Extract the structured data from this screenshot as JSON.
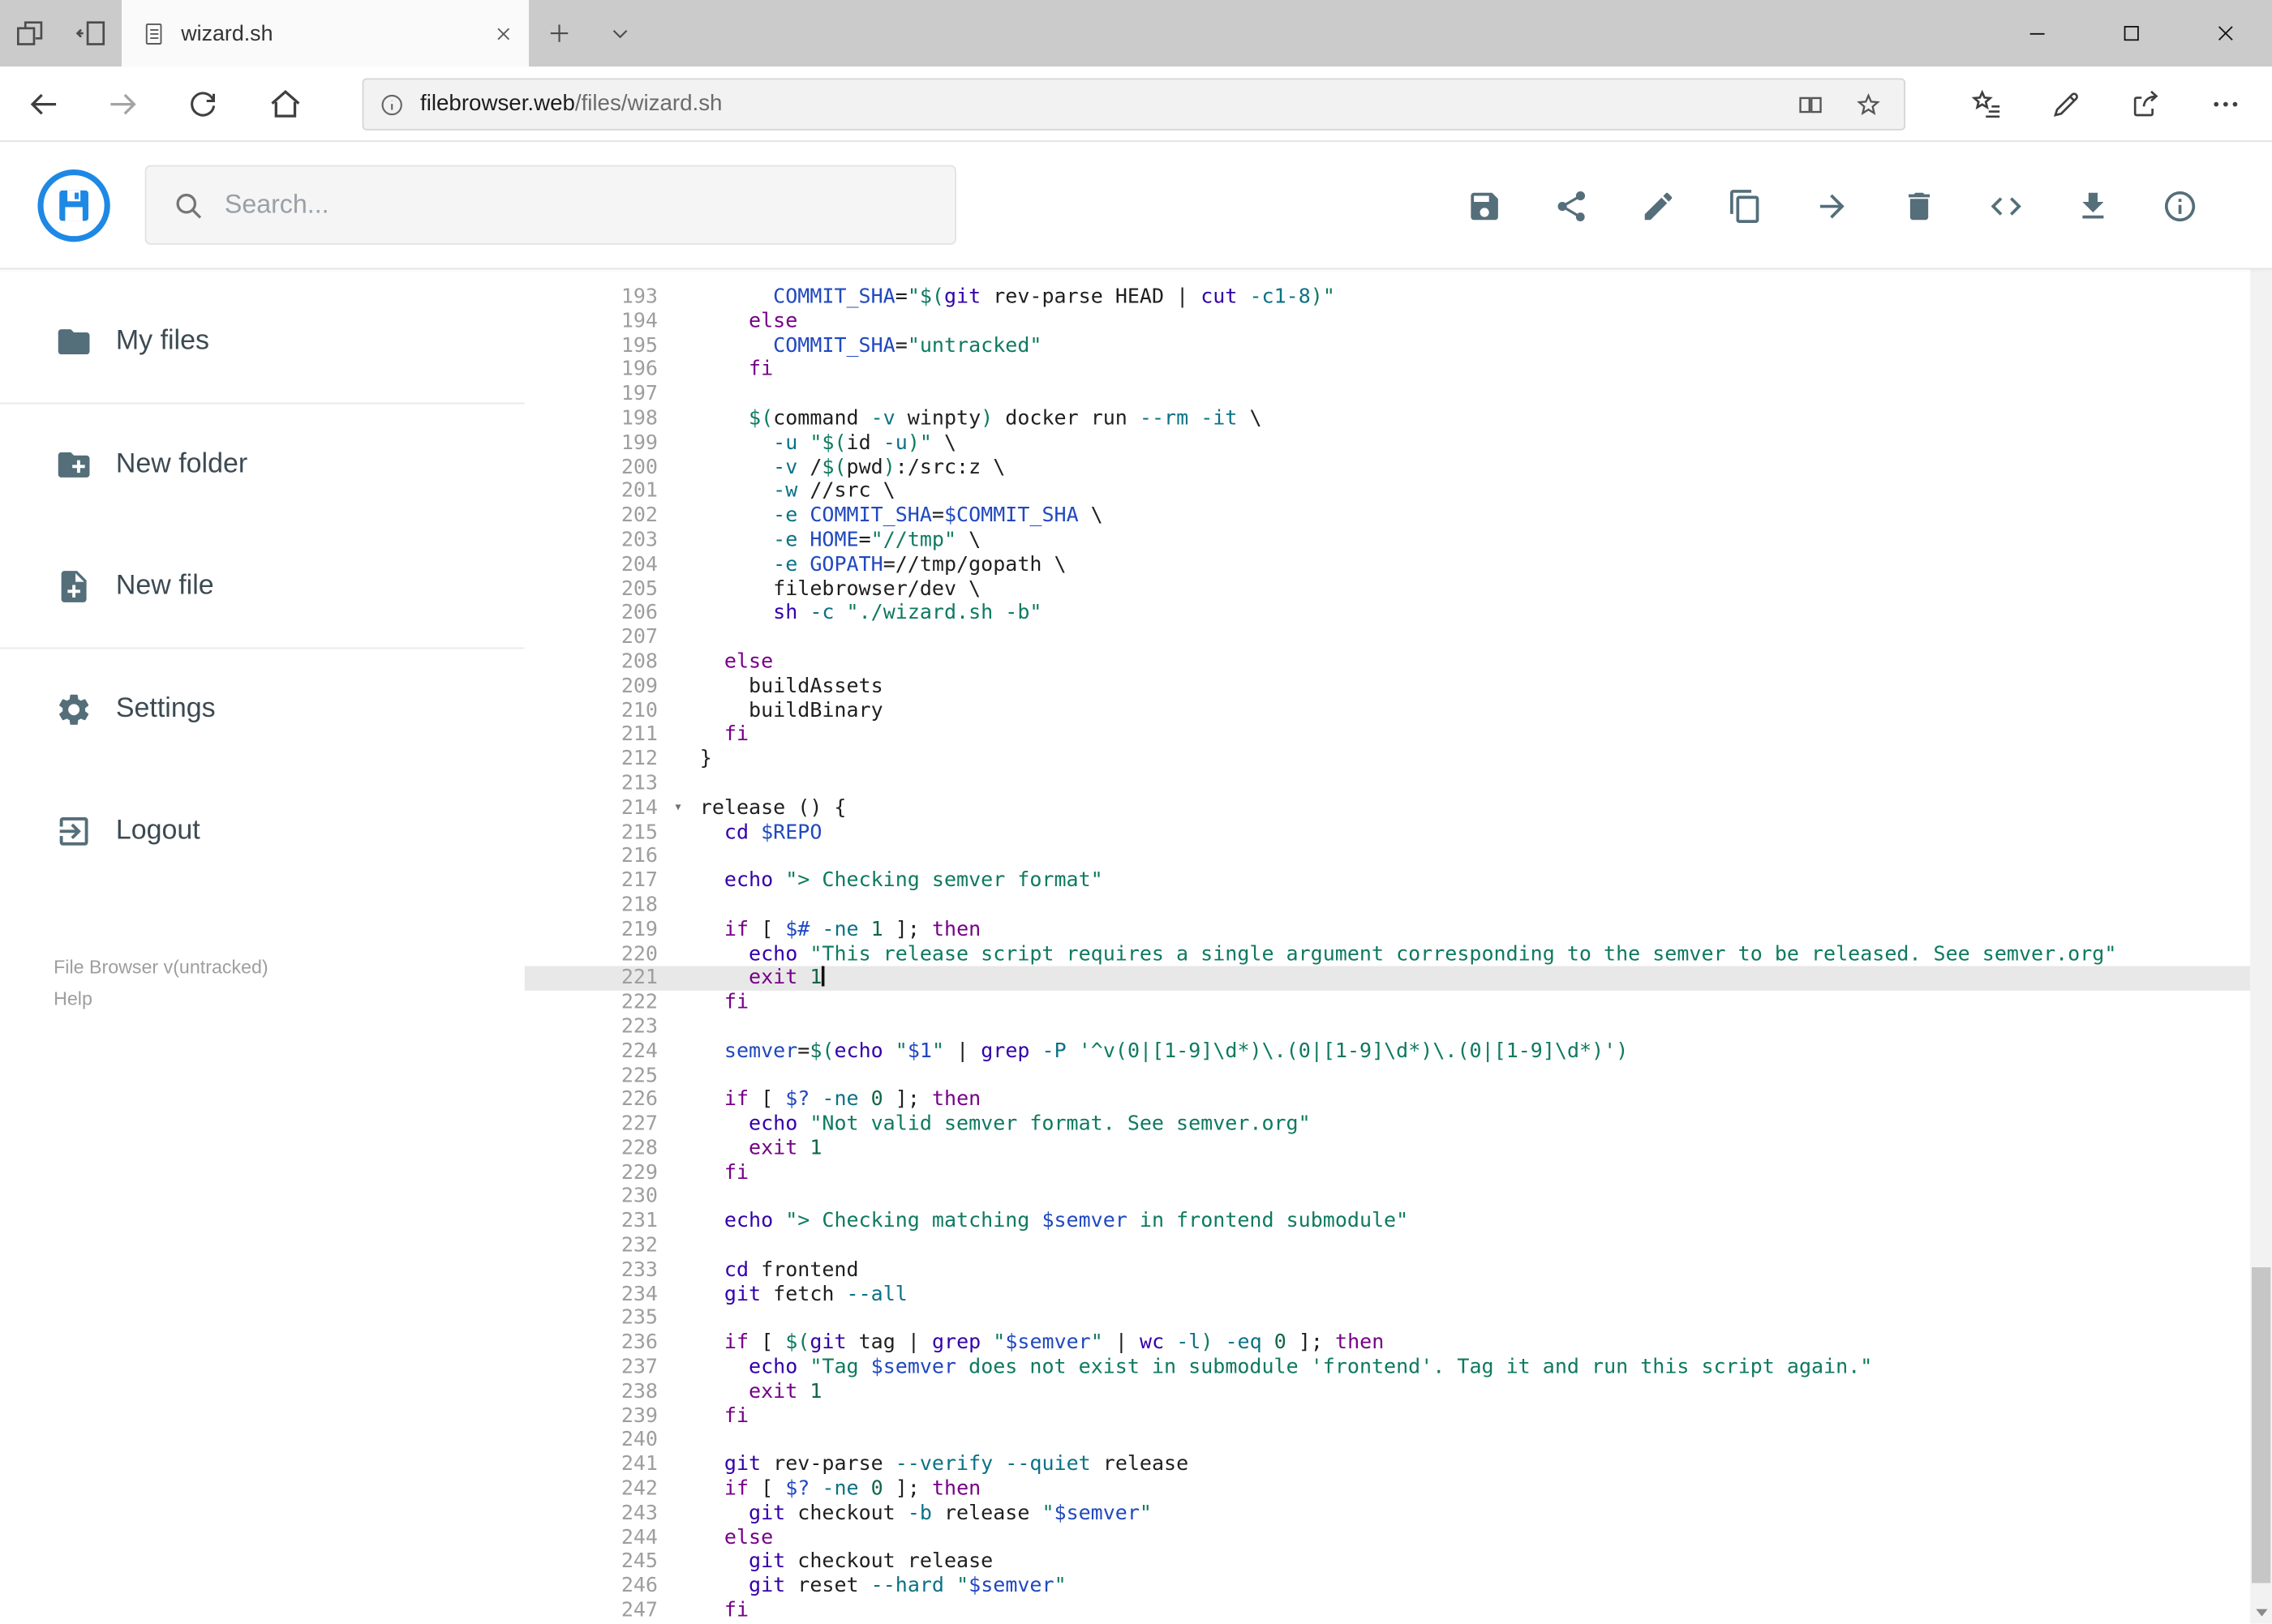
{
  "window": {
    "tab_title": "wizard.sh",
    "url_host": "filebrowser.web",
    "url_path": "/files/wizard.sh"
  },
  "header": {
    "search_placeholder": "Search..."
  },
  "toolbar_icons": [
    "save",
    "share",
    "rename",
    "copy",
    "move",
    "delete",
    "raw-view",
    "download",
    "info"
  ],
  "sidebar": {
    "items": [
      {
        "label": "My files",
        "icon": "folder"
      },
      {
        "label": "New folder",
        "icon": "create-new-folder"
      },
      {
        "label": "New file",
        "icon": "new-file"
      },
      {
        "label": "Settings",
        "icon": "settings"
      },
      {
        "label": "Logout",
        "icon": "logout"
      }
    ],
    "footer": {
      "version": "File Browser v(untracked)",
      "help": "Help"
    }
  },
  "colors": {
    "accent_blue": "#1e88e5",
    "icon_gray": "#546e7a",
    "active_line_bg": "#e8e8e8",
    "syntax": {
      "plain": "#1f1f1f",
      "keyword": "#770088",
      "string": "#0e7a60",
      "variable": "#2048c0",
      "flag": "#0b7285",
      "number": "#116644",
      "builtin": "#3300aa",
      "line_number": "#9e9e9e"
    }
  },
  "editor": {
    "active_line": 221,
    "cursor_line": 221,
    "fold_line": 214,
    "fold_marker": "▾",
    "lines": [
      {
        "n": 193,
        "s": [
          [
            "p",
            "      "
          ],
          [
            "v",
            "COMMIT_SHA"
          ],
          [
            "p",
            "="
          ],
          [
            "s",
            "\"$("
          ],
          [
            "b",
            "git"
          ],
          [
            "p",
            " rev-parse HEAD | "
          ],
          [
            "b",
            "cut"
          ],
          [
            "p",
            " "
          ],
          [
            "a",
            "-c1-8"
          ],
          [
            "s",
            ")\""
          ]
        ]
      },
      {
        "n": 194,
        "s": [
          [
            "p",
            "    "
          ],
          [
            "k",
            "else"
          ]
        ]
      },
      {
        "n": 195,
        "s": [
          [
            "p",
            "      "
          ],
          [
            "v",
            "COMMIT_SHA"
          ],
          [
            "p",
            "="
          ],
          [
            "s",
            "\"untracked\""
          ]
        ]
      },
      {
        "n": 196,
        "s": [
          [
            "p",
            "    "
          ],
          [
            "k",
            "fi"
          ]
        ]
      },
      {
        "n": 197,
        "s": []
      },
      {
        "n": 198,
        "s": [
          [
            "p",
            "    "
          ],
          [
            "s",
            "$("
          ],
          [
            "p",
            "command "
          ],
          [
            "a",
            "-v"
          ],
          [
            "p",
            " winpty"
          ],
          [
            "s",
            ")"
          ],
          [
            "p",
            " docker run "
          ],
          [
            "a",
            "--rm"
          ],
          [
            "p",
            " "
          ],
          [
            "a",
            "-it"
          ],
          [
            "p",
            " \\"
          ]
        ]
      },
      {
        "n": 199,
        "s": [
          [
            "p",
            "      "
          ],
          [
            "a",
            "-u"
          ],
          [
            "p",
            " "
          ],
          [
            "s",
            "\"$("
          ],
          [
            "p",
            "id "
          ],
          [
            "a",
            "-u"
          ],
          [
            "s",
            ")\""
          ],
          [
            "p",
            " \\"
          ]
        ]
      },
      {
        "n": 200,
        "s": [
          [
            "p",
            "      "
          ],
          [
            "a",
            "-v"
          ],
          [
            "p",
            " /"
          ],
          [
            "s",
            "$("
          ],
          [
            "p",
            "pwd"
          ],
          [
            "s",
            ")"
          ],
          [
            "p",
            ":/src:z \\"
          ]
        ]
      },
      {
        "n": 201,
        "s": [
          [
            "p",
            "      "
          ],
          [
            "a",
            "-w"
          ],
          [
            "p",
            " //src \\"
          ]
        ]
      },
      {
        "n": 202,
        "s": [
          [
            "p",
            "      "
          ],
          [
            "a",
            "-e"
          ],
          [
            "p",
            " "
          ],
          [
            "v",
            "COMMIT_SHA"
          ],
          [
            "p",
            "="
          ],
          [
            "v",
            "$COMMIT_SHA"
          ],
          [
            "p",
            " \\"
          ]
        ]
      },
      {
        "n": 203,
        "s": [
          [
            "p",
            "      "
          ],
          [
            "a",
            "-e"
          ],
          [
            "p",
            " "
          ],
          [
            "v",
            "HOME"
          ],
          [
            "p",
            "="
          ],
          [
            "s",
            "\"//tmp\""
          ],
          [
            "p",
            " \\"
          ]
        ]
      },
      {
        "n": 204,
        "s": [
          [
            "p",
            "      "
          ],
          [
            "a",
            "-e"
          ],
          [
            "p",
            " "
          ],
          [
            "v",
            "GOPATH"
          ],
          [
            "p",
            "=//tmp/gopath \\"
          ]
        ]
      },
      {
        "n": 205,
        "s": [
          [
            "p",
            "      filebrowser/dev \\"
          ]
        ]
      },
      {
        "n": 206,
        "s": [
          [
            "p",
            "      "
          ],
          [
            "b",
            "sh"
          ],
          [
            "p",
            " "
          ],
          [
            "a",
            "-c"
          ],
          [
            "p",
            " "
          ],
          [
            "s",
            "\"./wizard.sh -b\""
          ]
        ]
      },
      {
        "n": 207,
        "s": []
      },
      {
        "n": 208,
        "s": [
          [
            "p",
            "  "
          ],
          [
            "k",
            "else"
          ]
        ]
      },
      {
        "n": 209,
        "s": [
          [
            "p",
            "    buildAssets"
          ]
        ]
      },
      {
        "n": 210,
        "s": [
          [
            "p",
            "    buildBinary"
          ]
        ]
      },
      {
        "n": 211,
        "s": [
          [
            "p",
            "  "
          ],
          [
            "k",
            "fi"
          ]
        ]
      },
      {
        "n": 212,
        "s": [
          [
            "p",
            "}"
          ]
        ]
      },
      {
        "n": 213,
        "s": []
      },
      {
        "n": 214,
        "s": [
          [
            "p",
            "release () {"
          ]
        ]
      },
      {
        "n": 215,
        "s": [
          [
            "p",
            "  "
          ],
          [
            "b",
            "cd"
          ],
          [
            "p",
            " "
          ],
          [
            "v",
            "$REPO"
          ]
        ]
      },
      {
        "n": 216,
        "s": []
      },
      {
        "n": 217,
        "s": [
          [
            "p",
            "  "
          ],
          [
            "b",
            "echo"
          ],
          [
            "p",
            " "
          ],
          [
            "s",
            "\"> Checking semver format\""
          ]
        ]
      },
      {
        "n": 218,
        "s": []
      },
      {
        "n": 219,
        "s": [
          [
            "p",
            "  "
          ],
          [
            "k",
            "if"
          ],
          [
            "p",
            " [ "
          ],
          [
            "v",
            "$#"
          ],
          [
            "p",
            " "
          ],
          [
            "a",
            "-ne"
          ],
          [
            "p",
            " "
          ],
          [
            "n",
            "1"
          ],
          [
            "p",
            " ]; "
          ],
          [
            "k",
            "then"
          ]
        ]
      },
      {
        "n": 220,
        "s": [
          [
            "p",
            "    "
          ],
          [
            "b",
            "echo"
          ],
          [
            "p",
            " "
          ],
          [
            "s",
            "\"This release script requires a single argument corresponding to the semver to be released. See semver.org\""
          ]
        ]
      },
      {
        "n": 221,
        "s": [
          [
            "p",
            "    "
          ],
          [
            "k",
            "exit"
          ],
          [
            "p",
            " "
          ],
          [
            "n",
            "1"
          ]
        ]
      },
      {
        "n": 222,
        "s": [
          [
            "p",
            "  "
          ],
          [
            "k",
            "fi"
          ]
        ]
      },
      {
        "n": 223,
        "s": []
      },
      {
        "n": 224,
        "s": [
          [
            "p",
            "  "
          ],
          [
            "v",
            "semver"
          ],
          [
            "p",
            "="
          ],
          [
            "s",
            "$("
          ],
          [
            "b",
            "echo"
          ],
          [
            "p",
            " "
          ],
          [
            "s",
            "\""
          ],
          [
            "v",
            "$1"
          ],
          [
            "s",
            "\""
          ],
          [
            "p",
            " | "
          ],
          [
            "b",
            "grep"
          ],
          [
            "p",
            " "
          ],
          [
            "a",
            "-P"
          ],
          [
            "p",
            " "
          ],
          [
            "s",
            "'^v(0|[1-9]\\d*)\\.(0|[1-9]\\d*)\\.(0|[1-9]\\d*)'"
          ],
          [
            "s",
            ")"
          ]
        ]
      },
      {
        "n": 225,
        "s": []
      },
      {
        "n": 226,
        "s": [
          [
            "p",
            "  "
          ],
          [
            "k",
            "if"
          ],
          [
            "p",
            " [ "
          ],
          [
            "v",
            "$?"
          ],
          [
            "p",
            " "
          ],
          [
            "a",
            "-ne"
          ],
          [
            "p",
            " "
          ],
          [
            "n",
            "0"
          ],
          [
            "p",
            " ]; "
          ],
          [
            "k",
            "then"
          ]
        ]
      },
      {
        "n": 227,
        "s": [
          [
            "p",
            "    "
          ],
          [
            "b",
            "echo"
          ],
          [
            "p",
            " "
          ],
          [
            "s",
            "\"Not valid semver format. See semver.org\""
          ]
        ]
      },
      {
        "n": 228,
        "s": [
          [
            "p",
            "    "
          ],
          [
            "k",
            "exit"
          ],
          [
            "p",
            " "
          ],
          [
            "n",
            "1"
          ]
        ]
      },
      {
        "n": 229,
        "s": [
          [
            "p",
            "  "
          ],
          [
            "k",
            "fi"
          ]
        ]
      },
      {
        "n": 230,
        "s": []
      },
      {
        "n": 231,
        "s": [
          [
            "p",
            "  "
          ],
          [
            "b",
            "echo"
          ],
          [
            "p",
            " "
          ],
          [
            "s",
            "\"> Checking matching "
          ],
          [
            "v",
            "$semver"
          ],
          [
            "s",
            " in frontend submodule\""
          ]
        ]
      },
      {
        "n": 232,
        "s": []
      },
      {
        "n": 233,
        "s": [
          [
            "p",
            "  "
          ],
          [
            "b",
            "cd"
          ],
          [
            "p",
            " frontend"
          ]
        ]
      },
      {
        "n": 234,
        "s": [
          [
            "p",
            "  "
          ],
          [
            "b",
            "git"
          ],
          [
            "p",
            " fetch "
          ],
          [
            "a",
            "--all"
          ]
        ]
      },
      {
        "n": 235,
        "s": []
      },
      {
        "n": 236,
        "s": [
          [
            "p",
            "  "
          ],
          [
            "k",
            "if"
          ],
          [
            "p",
            " [ "
          ],
          [
            "s",
            "$("
          ],
          [
            "b",
            "git"
          ],
          [
            "p",
            " tag | "
          ],
          [
            "b",
            "grep"
          ],
          [
            "p",
            " "
          ],
          [
            "s",
            "\""
          ],
          [
            "v",
            "$semver"
          ],
          [
            "s",
            "\""
          ],
          [
            "p",
            " | "
          ],
          [
            "b",
            "wc"
          ],
          [
            "p",
            " "
          ],
          [
            "a",
            "-l"
          ],
          [
            "s",
            ")"
          ],
          [
            "p",
            " "
          ],
          [
            "a",
            "-eq"
          ],
          [
            "p",
            " "
          ],
          [
            "n",
            "0"
          ],
          [
            "p",
            " ]; "
          ],
          [
            "k",
            "then"
          ]
        ]
      },
      {
        "n": 237,
        "s": [
          [
            "p",
            "    "
          ],
          [
            "b",
            "echo"
          ],
          [
            "p",
            " "
          ],
          [
            "s",
            "\"Tag "
          ],
          [
            "v",
            "$semver"
          ],
          [
            "s",
            " does not exist in submodule 'frontend'. Tag it and run this script again.\""
          ]
        ]
      },
      {
        "n": 238,
        "s": [
          [
            "p",
            "    "
          ],
          [
            "k",
            "exit"
          ],
          [
            "p",
            " "
          ],
          [
            "n",
            "1"
          ]
        ]
      },
      {
        "n": 239,
        "s": [
          [
            "p",
            "  "
          ],
          [
            "k",
            "fi"
          ]
        ]
      },
      {
        "n": 240,
        "s": []
      },
      {
        "n": 241,
        "s": [
          [
            "p",
            "  "
          ],
          [
            "b",
            "git"
          ],
          [
            "p",
            " rev-parse "
          ],
          [
            "a",
            "--verify"
          ],
          [
            "p",
            " "
          ],
          [
            "a",
            "--quiet"
          ],
          [
            "p",
            " release"
          ]
        ]
      },
      {
        "n": 242,
        "s": [
          [
            "p",
            "  "
          ],
          [
            "k",
            "if"
          ],
          [
            "p",
            " [ "
          ],
          [
            "v",
            "$?"
          ],
          [
            "p",
            " "
          ],
          [
            "a",
            "-ne"
          ],
          [
            "p",
            " "
          ],
          [
            "n",
            "0"
          ],
          [
            "p",
            " ]; "
          ],
          [
            "k",
            "then"
          ]
        ]
      },
      {
        "n": 243,
        "s": [
          [
            "p",
            "    "
          ],
          [
            "b",
            "git"
          ],
          [
            "p",
            " checkout "
          ],
          [
            "a",
            "-b"
          ],
          [
            "p",
            " release "
          ],
          [
            "s",
            "\""
          ],
          [
            "v",
            "$semver"
          ],
          [
            "s",
            "\""
          ]
        ]
      },
      {
        "n": 244,
        "s": [
          [
            "p",
            "  "
          ],
          [
            "k",
            "else"
          ]
        ]
      },
      {
        "n": 245,
        "s": [
          [
            "p",
            "    "
          ],
          [
            "b",
            "git"
          ],
          [
            "p",
            " checkout release"
          ]
        ]
      },
      {
        "n": 246,
        "s": [
          [
            "p",
            "    "
          ],
          [
            "b",
            "git"
          ],
          [
            "p",
            " reset "
          ],
          [
            "a",
            "--hard"
          ],
          [
            "p",
            " "
          ],
          [
            "s",
            "\""
          ],
          [
            "v",
            "$semver"
          ],
          [
            "s",
            "\""
          ]
        ]
      },
      {
        "n": 247,
        "s": [
          [
            "p",
            "  "
          ],
          [
            "k",
            "fi"
          ]
        ]
      }
    ]
  }
}
